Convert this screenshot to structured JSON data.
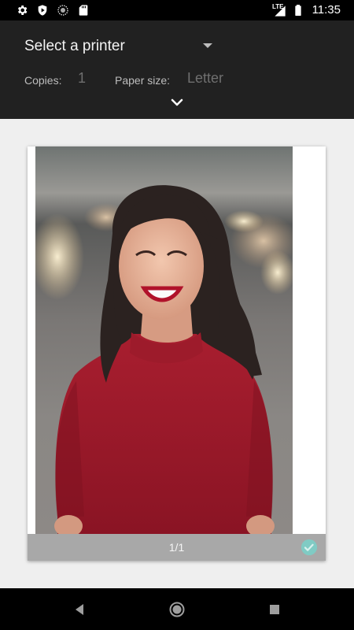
{
  "status_bar": {
    "time": "11:35",
    "network_label": "LTE",
    "icons": [
      "settings-icon",
      "shield-icon",
      "sync-icon",
      "sd-card-icon",
      "signal-icon",
      "battery-icon"
    ]
  },
  "header": {
    "printer_select": "Select a printer",
    "copies_label": "Copies:",
    "copies_value": "1",
    "paper_size_label": "Paper size:",
    "paper_size_value": "Letter"
  },
  "preview": {
    "page_counter": "1/1",
    "selected": true
  },
  "colors": {
    "header_bg": "#212121",
    "preview_bg": "#efefef",
    "accent_check": "#80cbc4",
    "footer_bg": "#a8a8a8"
  },
  "nav_bar": {
    "icons": [
      "back-icon",
      "home-icon",
      "recents-icon"
    ]
  }
}
